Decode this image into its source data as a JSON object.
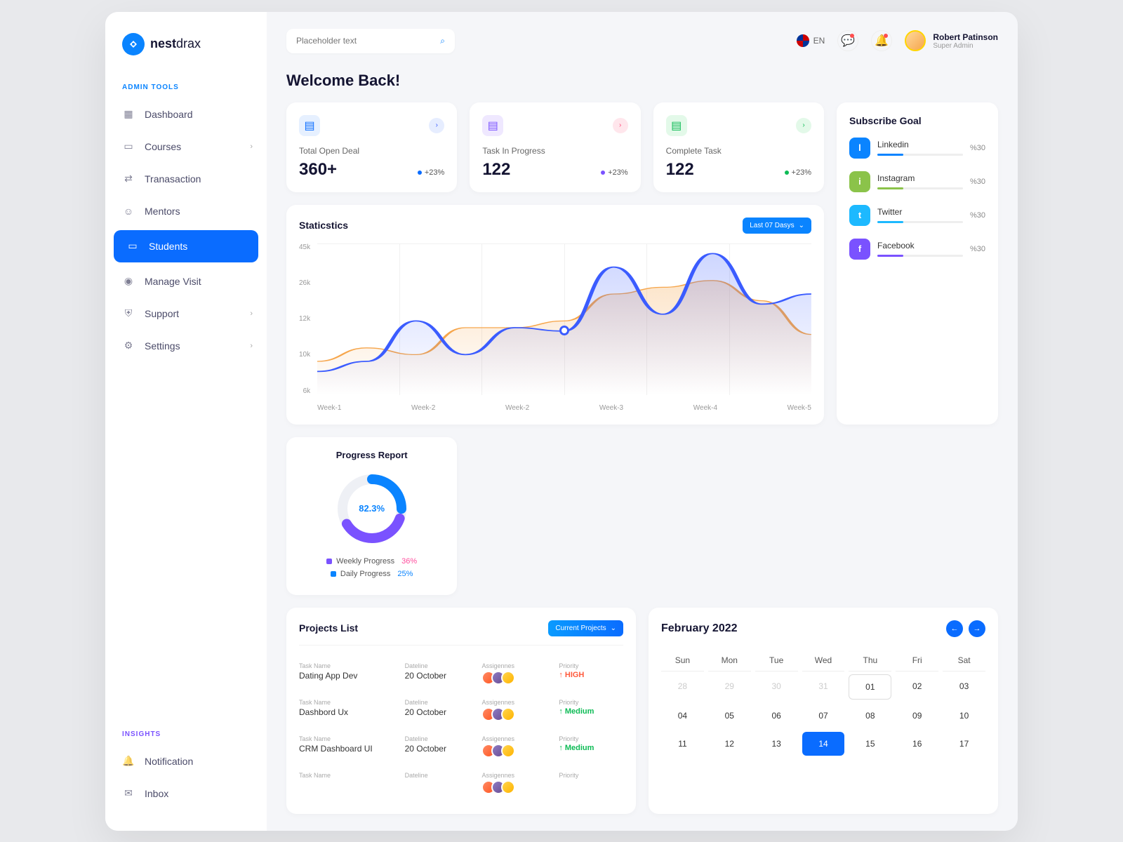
{
  "brand": {
    "name_bold": "nest",
    "name_light": "drax"
  },
  "sidebar": {
    "section1": "ADMIN TOOLS",
    "section2": "INSIGHTS",
    "items": [
      {
        "label": "Dashboard"
      },
      {
        "label": "Courses",
        "expandable": true
      },
      {
        "label": "Tranasaction"
      },
      {
        "label": "Mentors"
      },
      {
        "label": "Students",
        "active": true
      },
      {
        "label": "Manage Visit"
      },
      {
        "label": "Support",
        "expandable": true
      },
      {
        "label": "Settings",
        "expandable": true
      }
    ],
    "insights": [
      {
        "label": "Notification"
      },
      {
        "label": "Inbox"
      }
    ]
  },
  "topbar": {
    "search_placeholder": "Placeholder text",
    "lang": "EN",
    "user_name": "Robert Patinson",
    "user_role": "Super Admin"
  },
  "welcome": "Welcome Back!",
  "stats": [
    {
      "label": "Total Open Deal",
      "value": "360+",
      "change": "+23%",
      "color": "blue",
      "arrow": "blue"
    },
    {
      "label": "Task In Progress",
      "value": "122",
      "change": "+23%",
      "color": "purple",
      "arrow": "pink"
    },
    {
      "label": "Complete Task",
      "value": "122",
      "change": "+23%",
      "color": "green",
      "arrow": "green"
    }
  ],
  "subscribe": {
    "title": "Subscribe Goal",
    "items": [
      {
        "name": "Linkedin",
        "pct": "%30",
        "fill": 30,
        "cls": "in",
        "color": "#0a84ff"
      },
      {
        "name": "Instagram",
        "pct": "%30",
        "fill": 30,
        "cls": "ig",
        "color": "#8bc34a"
      },
      {
        "name": "Twitter",
        "pct": "%30",
        "fill": 30,
        "cls": "tw",
        "color": "#1db9ff"
      },
      {
        "name": "Facebook",
        "pct": "%30",
        "fill": 30,
        "cls": "fb",
        "color": "#7a52ff"
      }
    ]
  },
  "statistics": {
    "title": "Staticstics",
    "period": "Last 07 Dasys"
  },
  "chart_data": {
    "type": "line",
    "x_labels": [
      "Week-1",
      "Week-2",
      "Week-2",
      "Week-3",
      "Week-4",
      "Week-5"
    ],
    "y_ticks": [
      "45k",
      "26k",
      "12k",
      "10k",
      "6k"
    ],
    "series": [
      {
        "name": "primary",
        "color": "#3b5cff",
        "values": [
          7,
          10,
          22,
          12,
          20,
          19,
          38,
          24,
          42,
          27,
          30
        ]
      },
      {
        "name": "secondary",
        "color": "#f6a64c",
        "values": [
          10,
          14,
          12,
          20,
          20,
          22,
          30,
          32,
          34,
          28,
          18
        ]
      }
    ],
    "highlight_point_index": 5
  },
  "progress": {
    "title": "Progress Report",
    "center": "82.3%",
    "legend": [
      {
        "label": "Weekly Progress",
        "val": "36%",
        "cls": "purple"
      },
      {
        "label": "Daily Progress",
        "val": "25%",
        "cls": "blue"
      }
    ]
  },
  "projects": {
    "title": "Projects List",
    "filter": "Current Projects",
    "col_task": "Task Name",
    "col_date": "Dateline",
    "col_assign": "Assigennes",
    "col_priority": "Priority",
    "rows": [
      {
        "name": "Dating App Dev",
        "date": "20 October",
        "priority": "↑ HIGH",
        "pcls": ""
      },
      {
        "name": "Dashbord Ux",
        "date": "20 October",
        "priority": "↑ Medium",
        "pcls": "med"
      },
      {
        "name": "CRM Dashboard UI",
        "date": "20 October",
        "priority": "↑ Medium",
        "pcls": "med"
      },
      {
        "name": "",
        "date": "",
        "priority": "",
        "pcls": ""
      }
    ]
  },
  "calendar": {
    "title": "February 2022",
    "dayheads": [
      "Sun",
      "Mon",
      "Tue",
      "Wed",
      "Thu",
      "Fri",
      "Sat"
    ],
    "cells": [
      {
        "d": "28",
        "cls": "other"
      },
      {
        "d": "29",
        "cls": "other"
      },
      {
        "d": "30",
        "cls": "other"
      },
      {
        "d": "31",
        "cls": "other"
      },
      {
        "d": "01",
        "cls": "outline"
      },
      {
        "d": "02",
        "cls": ""
      },
      {
        "d": "03",
        "cls": ""
      },
      {
        "d": "04",
        "cls": ""
      },
      {
        "d": "05",
        "cls": ""
      },
      {
        "d": "06",
        "cls": ""
      },
      {
        "d": "07",
        "cls": ""
      },
      {
        "d": "08",
        "cls": ""
      },
      {
        "d": "09",
        "cls": ""
      },
      {
        "d": "10",
        "cls": ""
      },
      {
        "d": "11",
        "cls": ""
      },
      {
        "d": "12",
        "cls": ""
      },
      {
        "d": "13",
        "cls": ""
      },
      {
        "d": "14",
        "cls": "sel"
      },
      {
        "d": "15",
        "cls": ""
      },
      {
        "d": "16",
        "cls": ""
      },
      {
        "d": "17",
        "cls": ""
      }
    ]
  }
}
